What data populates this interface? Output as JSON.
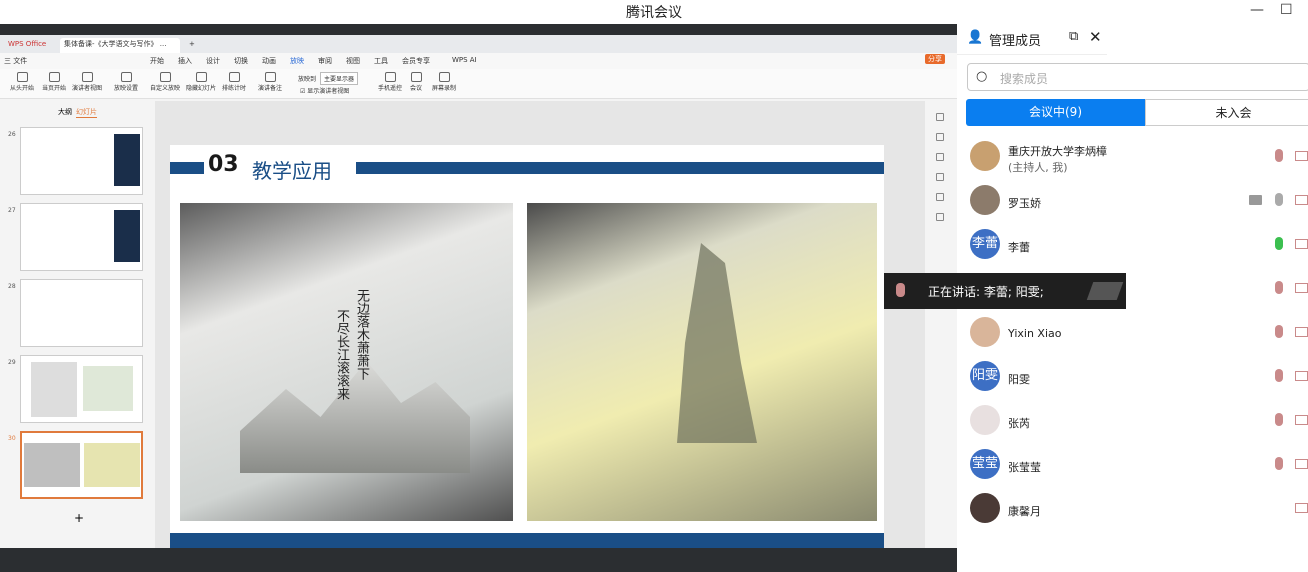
{
  "window": {
    "title": "腾讯会议"
  },
  "wps": {
    "tabs": [
      "WPS Office",
      "集体备课-《大学语文与写作》 ..."
    ],
    "menu": [
      "三 文件",
      "开始",
      "插入",
      "设计",
      "切换",
      "动画",
      "放映",
      "审阅",
      "视图",
      "工具",
      "会员专享",
      "WPS AI",
      "分享"
    ],
    "ribbon": [
      "从头开始",
      "当页开始",
      "演讲者视图",
      "放映设置",
      "自定义放映",
      "隐藏幻灯片",
      "排练计时",
      "演讲备注",
      "放映到",
      "主要显示器",
      "显示演讲者视图",
      "手机遥控",
      "会议",
      "屏幕录制"
    ],
    "sidebar_tabs": [
      "大纲",
      "幻灯片"
    ],
    "slide_numbers": [
      "26",
      "27",
      "28",
      "29",
      "30"
    ],
    "add_slide": "+"
  },
  "slide": {
    "num": "03",
    "heading": "教学应用",
    "poem_lines": [
      "无边落木萧萧下",
      "不尽长江滚滚来"
    ]
  },
  "panel": {
    "title": "管理成员",
    "search_placeholder": "搜索成员",
    "tab_in": "会议中(9)",
    "tab_out": "未入会",
    "members": [
      {
        "name": "重庆开放大学李炳樟",
        "sub": "(主持人, 我)",
        "avatar": "",
        "color": "#c8a070",
        "speaking": false
      },
      {
        "name": "罗玉娇",
        "sub": "",
        "avatar": "",
        "color": "#8c7b6b",
        "speaking": false
      },
      {
        "name": "李蕾",
        "sub": "",
        "avatar": "李蕾",
        "color": "#3d6fc4",
        "speaking": true
      },
      {
        "name": "",
        "sub": "",
        "avatar": "",
        "color": "#3d6fc4",
        "speaking": false
      },
      {
        "name": "Yixin Xiao",
        "sub": "",
        "avatar": "",
        "color": "#d9b59a",
        "speaking": false
      },
      {
        "name": "阳雯",
        "sub": "",
        "avatar": "阳雯",
        "color": "#3d6fc4",
        "speaking": false
      },
      {
        "name": "张芮",
        "sub": "",
        "avatar": "",
        "color": "#e8e0e0",
        "speaking": false
      },
      {
        "name": "张莹莹",
        "sub": "",
        "avatar": "莹莹",
        "color": "#3d6fc4",
        "speaking": false
      },
      {
        "name": "康馨月",
        "sub": "",
        "avatar": "",
        "color": "#4a3a36",
        "speaking": false
      }
    ],
    "speaking_label": "正在讲话: 李蕾; 阳雯;"
  },
  "colors": {
    "accent": "#0a7ef0",
    "slide_bar": "#1a4e86",
    "mic_green": "#3bbf4f",
    "mic_off": "#c98a8a"
  }
}
